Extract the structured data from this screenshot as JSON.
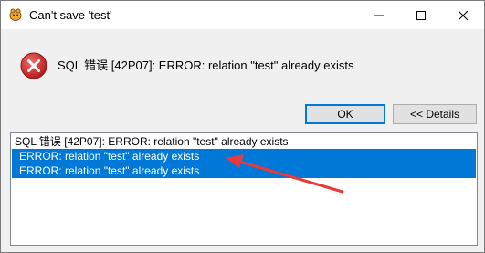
{
  "window": {
    "title": "Can't save 'test'"
  },
  "message": {
    "text": "SQL 错误 [42P07]: ERROR: relation \"test\" already exists"
  },
  "buttons": {
    "ok_label": "OK",
    "details_label": "<< Details"
  },
  "details": {
    "lines": [
      "SQL 错误 [42P07]: ERROR: relation \"test\" already exists",
      "ERROR: relation \"test\" already exists",
      "ERROR: relation \"test\" already exists"
    ]
  },
  "icons": {
    "app": "app-icon",
    "error": "error-icon",
    "minimize": "minimize-icon",
    "maximize": "maximize-icon",
    "close": "close-icon",
    "annotation": "annotation-arrow"
  },
  "colors": {
    "selection": "#0078d7",
    "error_red": "#d42a2a",
    "arrow_red": "#e83a3a"
  }
}
